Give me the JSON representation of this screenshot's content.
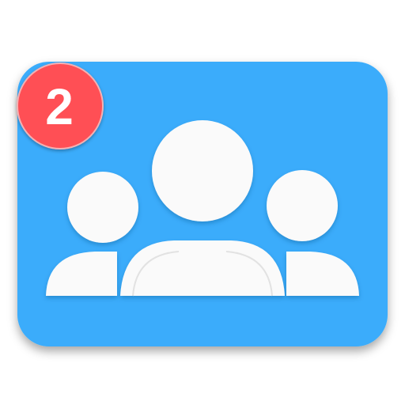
{
  "app_icon": {
    "icon_name": "group-contacts-icon",
    "accent_color": "#3AACFB",
    "badge": {
      "count": "2",
      "color": "#FF4F55"
    }
  }
}
